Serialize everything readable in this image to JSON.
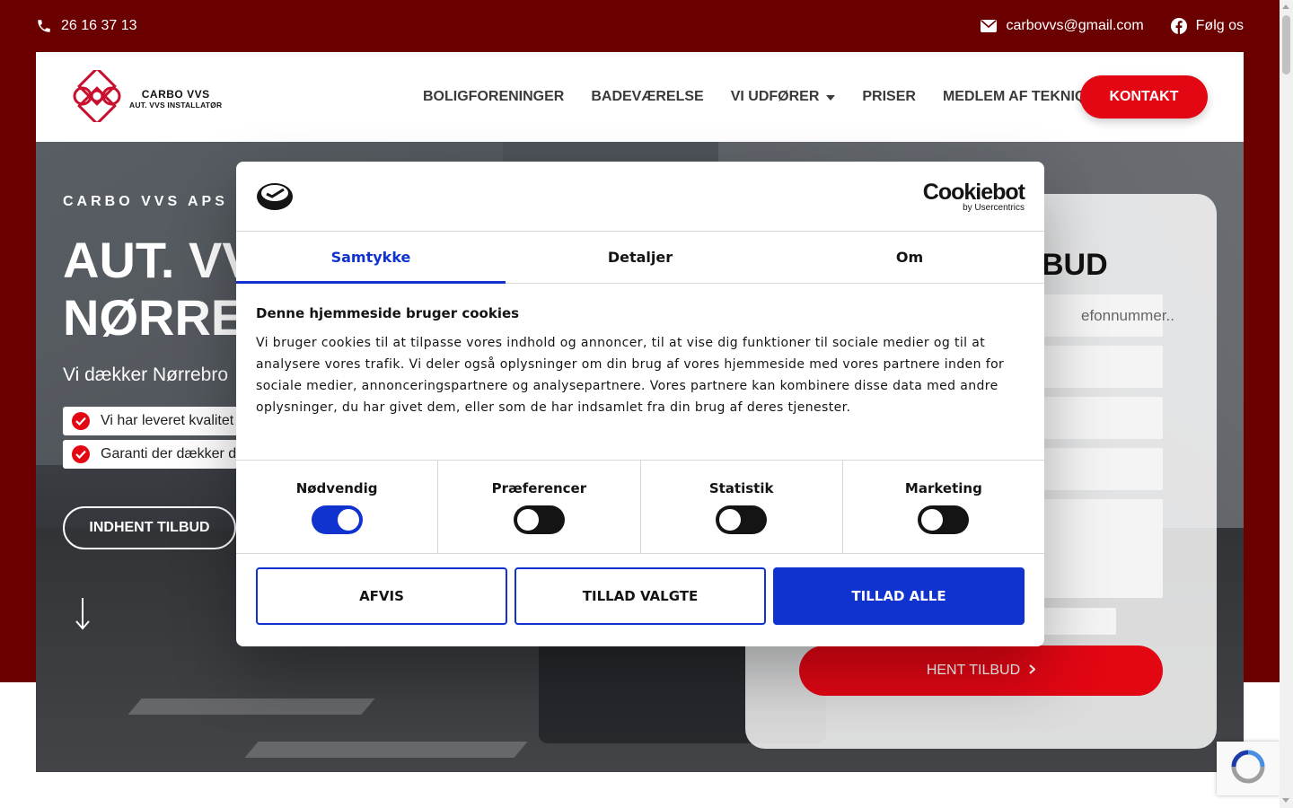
{
  "topbar": {
    "phone": "26 16 37 13",
    "email": "carbovvs@gmail.com",
    "follow": "Følg os"
  },
  "brand": {
    "name": "CARBO VVS",
    "tagline": "AUT. VVS INSTALLATØR",
    "color": "#e30613"
  },
  "nav": {
    "items": [
      "BOLIGFORENINGER",
      "BADEVÆRELSE",
      "VI UDFØRER",
      "PRISER",
      "MEDLEM AF TEKNIQ"
    ],
    "cta": "KONTAKT"
  },
  "hero": {
    "eyebrow": "CARBO VVS APS",
    "title": "AUT. VV\nNØRREI",
    "subtitle": "Vi dækker Nørrebro",
    "checks": [
      "Vi har leveret kvalitet",
      "Garanti der dækker d"
    ],
    "button": "INDHENT TILBUD"
  },
  "form": {
    "title_fragment": "BUD",
    "phone_placeholder_fragment": "efonnummer..",
    "submit": "HENT TILBUD"
  },
  "cookie": {
    "brand_main": "Cookiebot",
    "brand_sub": "by Usercentrics",
    "tabs": [
      "Samtykke",
      "Detaljer",
      "Om"
    ],
    "heading": "Denne hjemmeside bruger cookies",
    "body": "Vi bruger cookies til at tilpasse vores indhold og annoncer, til at vise dig funktioner til sociale medier og til at analysere vores trafik. Vi deler også oplysninger om din brug af vores hjemmeside med vores partnere inden for sociale medier, annonceringspartnere og analysepartnere. Vores partnere kan kombinere disse data med andre oplysninger, du har givet dem, eller som de har indsamlet fra din brug af deres tjenester.",
    "toggles": [
      {
        "label": "Nødvendig",
        "on": true
      },
      {
        "label": "Præferencer",
        "on": false
      },
      {
        "label": "Statistik",
        "on": false
      },
      {
        "label": "Marketing",
        "on": false
      }
    ],
    "buttons": {
      "deny": "AFVIS",
      "selected": "TILLAD VALGTE",
      "all": "TILLAD ALLE"
    },
    "accent": "#1032cf"
  }
}
